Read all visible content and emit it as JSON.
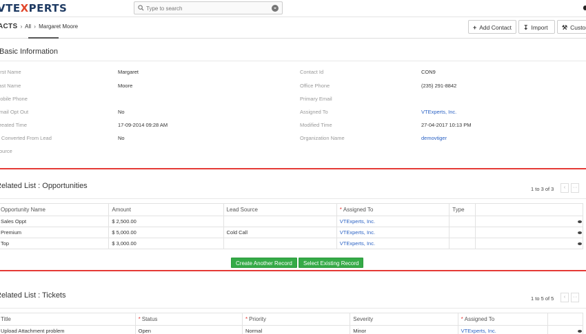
{
  "header": {
    "logo_prefix": "VTE",
    "logo_x": "X",
    "logo_suffix": "PERTS",
    "search_placeholder": "Type to search",
    "search_icon": "search-icon",
    "dropdown_icon": "chevron-down-icon"
  },
  "breadcrumb": {
    "module": "ACTS",
    "all": "All",
    "record": "Margaret Moore"
  },
  "actions": {
    "add_contact": "Add Contact",
    "import": "Import",
    "customize": "Customize"
  },
  "basic": {
    "title": "Basic Information",
    "left": [
      {
        "label": "First Name",
        "value": "Margaret"
      },
      {
        "label": "Last Name",
        "value": "Moore"
      },
      {
        "label": "Mobile Phone",
        "value": ""
      },
      {
        "label": "Email Opt Out",
        "value": "No"
      },
      {
        "label": "Created Time",
        "value": "17-09-2014 09:28 AM"
      },
      {
        "label": "Is Converted From Lead",
        "value": "No"
      },
      {
        "label": "Source",
        "value": ""
      }
    ],
    "right": [
      {
        "label": "Contact Id",
        "value": "CON9"
      },
      {
        "label": "Office Phone",
        "value": "(235) 291-8842"
      },
      {
        "label": "Primary Email",
        "value": ""
      },
      {
        "label": "Assigned To",
        "value": "VTExperts, Inc."
      },
      {
        "label": "Modified Time",
        "value": "27-04-2017 10:13 PM"
      },
      {
        "label": "Organization Name",
        "value": "demovtiger"
      }
    ]
  },
  "opportunities": {
    "title": "Related List : Opportunities",
    "pager": "1 to 3 of 3",
    "columns": [
      "Opportunity Name",
      "Amount",
      "Lead Source",
      "Assigned To",
      "Type"
    ],
    "rows": [
      {
        "name": "Sales Oppt",
        "amount": "$ 2,500.00",
        "lead_source": "",
        "assigned": "VTExperts, Inc.",
        "type": ""
      },
      {
        "name": "Premium",
        "amount": "$ 5,000.00",
        "lead_source": "Cold Call",
        "assigned": "VTExperts, Inc.",
        "type": ""
      },
      {
        "name": "Top",
        "amount": "$ 3,000.00",
        "lead_source": "",
        "assigned": "VTExperts, Inc.",
        "type": ""
      }
    ],
    "create_btn": "Create Another Record",
    "select_btn": "Select Existing Record"
  },
  "tickets": {
    "title": "Related List : Tickets",
    "pager": "1 to 5 of 5",
    "columns": [
      "Title",
      "Status",
      "Priority",
      "Severity",
      "Assigned To"
    ],
    "rows": [
      {
        "title": "Upload Attachment problem",
        "status": "Open",
        "priority": "Normal",
        "severity": "Minor",
        "assigned": "VTExperts, Inc."
      }
    ]
  },
  "colors": {
    "accent_red": "#e53935",
    "link_blue": "#2b62c4",
    "button_green": "#35aa47"
  }
}
